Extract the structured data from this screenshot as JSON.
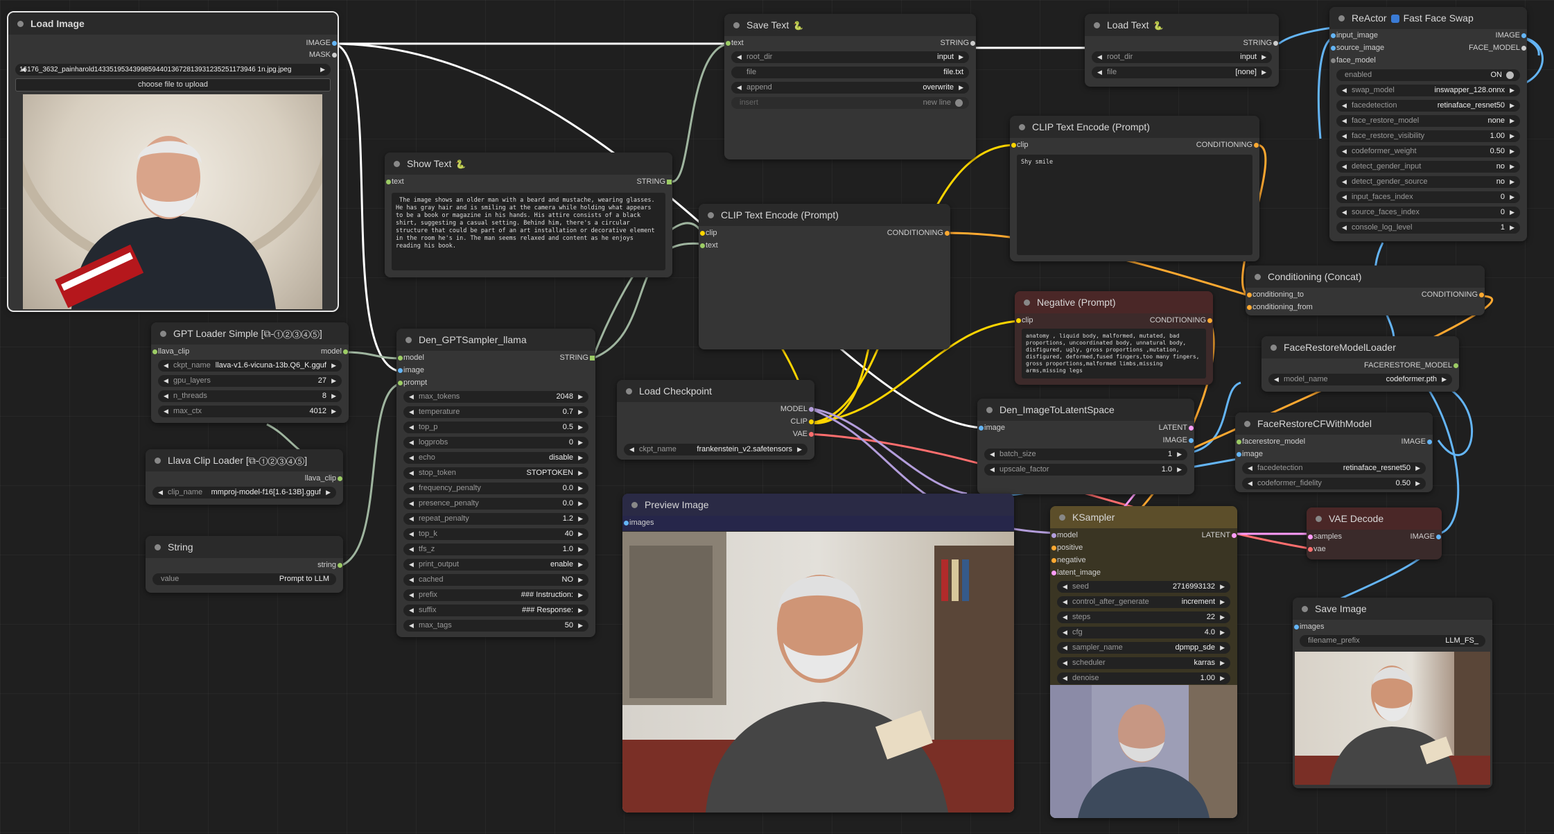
{
  "colors": {
    "image": "#64b5f6",
    "string": "#9ccc65",
    "model": "#b39ddb",
    "clip": "#ffd500",
    "vae": "#ff6e6e",
    "conditioning": "#ffa931",
    "latent": "#ff9cf9",
    "face_model": "#cccccc",
    "llava": "#9ccc65"
  },
  "load_image": {
    "title": "Load Image",
    "out_image": "IMAGE",
    "out_mask": "MASK",
    "file": "16176_3632_painharold143351953439985944013672813931235251173946 1n.jpg.jpeg",
    "upload": "choose file to upload"
  },
  "show_text": {
    "title": "Show Text",
    "emoji": "🐍",
    "in_text": "text",
    "out_string": "STRING",
    "content": " The image shows an older man with a beard and mustache, wearing glasses. He has gray hair and is smiling at the camera while holding what appears to be a book or magazine in his hands. His attire consists of a black shirt, suggesting a casual setting. Behind him, there's a circular structure that could be part of an art installation or decorative element in the room he's in. The man seems relaxed and content as he enjoys reading his book."
  },
  "save_text": {
    "title": "Save Text",
    "emoji": "🐍",
    "in_text": "text",
    "out_string": "STRING",
    "widgets": [
      {
        "label": "root_dir",
        "value": "input"
      },
      {
        "label": "file",
        "value": "file.txt"
      },
      {
        "label": "append",
        "value": "overwrite"
      }
    ],
    "insert_label": "insert",
    "insert_value": "new line"
  },
  "load_text": {
    "title": "Load Text",
    "emoji": "🐍",
    "out_string": "STRING",
    "widgets": [
      {
        "label": "root_dir",
        "value": "input"
      },
      {
        "label": "file",
        "value": "[none]"
      }
    ]
  },
  "reactor": {
    "title": "ReActor",
    "title2": "Fast Face Swap",
    "in_input_image": "input_image",
    "in_source_image": "source_image",
    "in_face_model": "face_model",
    "out_image": "IMAGE",
    "out_face_model": "FACE_MODEL",
    "enabled_label": "enabled",
    "enabled_value": "ON",
    "widgets": [
      {
        "label": "swap_model",
        "value": "inswapper_128.onnx"
      },
      {
        "label": "facedetection",
        "value": "retinaface_resnet50"
      },
      {
        "label": "face_restore_model",
        "value": "none"
      },
      {
        "label": "face_restore_visibility",
        "value": "1.00"
      },
      {
        "label": "codeformer_weight",
        "value": "0.50"
      },
      {
        "label": "detect_gender_input",
        "value": "no"
      },
      {
        "label": "detect_gender_source",
        "value": "no"
      },
      {
        "label": "input_faces_index",
        "value": "0"
      },
      {
        "label": "source_faces_index",
        "value": "0"
      },
      {
        "label": "console_log_level",
        "value": "1"
      }
    ]
  },
  "clip_encode_top": {
    "title": "CLIP Text Encode (Prompt)",
    "in_clip": "clip",
    "out_conditioning": "CONDITIONING",
    "content": "Shy smile"
  },
  "clip_encode_mid": {
    "title": "CLIP Text Encode (Prompt)",
    "in_clip": "clip",
    "in_text": "text",
    "out_conditioning": "CONDITIONING"
  },
  "conditioning_concat": {
    "title": "Conditioning (Concat)",
    "in_to": "conditioning_to",
    "in_from": "conditioning_from",
    "out": "CONDITIONING"
  },
  "negative": {
    "title": "Negative (Prompt)",
    "in_clip": "clip",
    "out": "CONDITIONING",
    "content": "anatomy , liquid body, malformed, mutated, bad proportions, uncoordinated body, unnatural body, disfigured, ugly, gross proportions ,mutation, disfigured, deformed,fused fingers,too many fingers, gross proportions,malformed limbs,missing arms,missing legs"
  },
  "face_restore_loader": {
    "title": "FaceRestoreModelLoader",
    "out": "FACERESTORE_MODEL",
    "widget_label": "model_name",
    "widget_value": "codeformer.pth"
  },
  "face_restore_cf": {
    "title": "FaceRestoreCFWithModel",
    "in_model": "facerestore_model",
    "in_image": "image",
    "out": "IMAGE",
    "widgets": [
      {
        "label": "facedetection",
        "value": "retinaface_resnet50"
      },
      {
        "label": "codeformer_fidelity",
        "value": "0.50"
      }
    ]
  },
  "gpt_loader": {
    "title": "GPT Loader Simple [⧉-➀➁➂➃➄]",
    "in": "llava_clip",
    "out": "model",
    "widgets": [
      {
        "label": "ckpt_name",
        "value": "llava-v1.6-vicuna-13b.Q6_K.gguf"
      },
      {
        "label": "gpu_layers",
        "value": "27"
      },
      {
        "label": "n_threads",
        "value": "8"
      },
      {
        "label": "max_ctx",
        "value": "4012"
      }
    ]
  },
  "llava_clip": {
    "title": "Llava Clip Loader [⧉-➀➁➂➃➄]",
    "out": "llava_clip",
    "widget_label": "clip_name",
    "widget_value": "mmproj-model-f16[1.6-13B].gguf"
  },
  "string_node": {
    "title": "String",
    "out": "string",
    "widget_label": "value",
    "widget_value": "Prompt to LLM"
  },
  "gpt_sampler": {
    "title": "Den_GPTSampler_llama",
    "in_model": "model",
    "in_image": "image",
    "in_prompt": "prompt",
    "out": "STRING",
    "widgets": [
      {
        "label": "max_tokens",
        "value": "2048"
      },
      {
        "label": "temperature",
        "value": "0.7"
      },
      {
        "label": "top_p",
        "value": "0.5"
      },
      {
        "label": "logprobs",
        "value": "0"
      },
      {
        "label": "echo",
        "value": "disable"
      },
      {
        "label": "stop_token",
        "value": "STOPTOKEN"
      },
      {
        "label": "frequency_penalty",
        "value": "0.0"
      },
      {
        "label": "presence_penalty",
        "value": "0.0"
      },
      {
        "label": "repeat_penalty",
        "value": "1.2"
      },
      {
        "label": "top_k",
        "value": "40"
      },
      {
        "label": "tfs_z",
        "value": "1.0"
      },
      {
        "label": "print_output",
        "value": "enable"
      },
      {
        "label": "cached",
        "value": "NO"
      },
      {
        "label": "prefix",
        "value": "### Instruction:"
      },
      {
        "label": "suffix",
        "value": "### Response:"
      },
      {
        "label": "max_tags",
        "value": "50"
      }
    ]
  },
  "load_checkpoint": {
    "title": "Load Checkpoint",
    "out_model": "MODEL",
    "out_clip": "CLIP",
    "out_vae": "VAE",
    "widget_label": "ckpt_name",
    "widget_value": "frankenstein_v2.safetensors"
  },
  "img_to_latent": {
    "title": "Den_ImageToLatentSpace",
    "in_image": "image",
    "out_latent": "LATENT",
    "out_image": "IMAGE",
    "widgets": [
      {
        "label": "batch_size",
        "value": "1"
      },
      {
        "label": "upscale_factor",
        "value": "1.0"
      }
    ]
  },
  "preview": {
    "title": "Preview Image",
    "in": "images"
  },
  "ksampler": {
    "title": "KSampler",
    "in_model": "model",
    "in_positive": "positive",
    "in_negative": "negative",
    "in_latent": "latent_image",
    "out": "LATENT",
    "widgets": [
      {
        "label": "seed",
        "value": "2716993132"
      },
      {
        "label": "control_after_generate",
        "value": "increment"
      },
      {
        "label": "steps",
        "value": "22"
      },
      {
        "label": "cfg",
        "value": "4.0"
      },
      {
        "label": "sampler_name",
        "value": "dpmpp_sde"
      },
      {
        "label": "scheduler",
        "value": "karras"
      },
      {
        "label": "denoise",
        "value": "1.00"
      }
    ]
  },
  "vae_decode": {
    "title": "VAE Decode",
    "in_samples": "samples",
    "in_vae": "vae",
    "out": "IMAGE"
  },
  "save_image": {
    "title": "Save Image",
    "in": "images",
    "widget_label": "filename_prefix",
    "widget_value": "LLM_FS_"
  }
}
